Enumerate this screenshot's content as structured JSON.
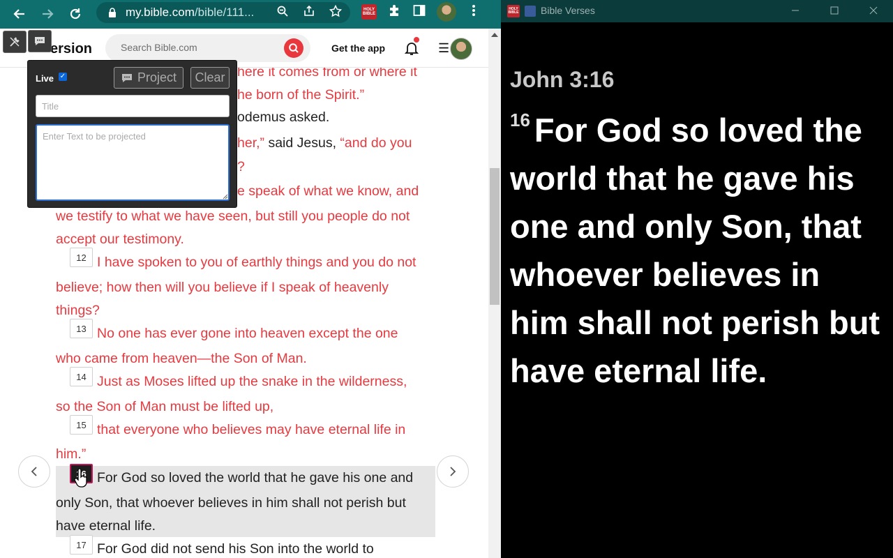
{
  "browser": {
    "url_host": "my.bible.com",
    "url_path": "/bible/111...",
    "ext_label": "HOLY BIBLE"
  },
  "site": {
    "logo_text": "ersion",
    "search_placeholder": "Search Bible.com",
    "get_app": "Get the app"
  },
  "toolbox": {
    "live_label": "Live",
    "live_checked": true,
    "project_label": "Project",
    "clear_label": "Clear",
    "title_placeholder": "Title",
    "text_placeholder": "Enter Text to be projected"
  },
  "passage": {
    "lines": [
      {
        "text": "here it comes from or where it",
        "color": "red"
      },
      {
        "text": "he born of the Spirit.”",
        "color": "red"
      },
      {
        "text": "odemus asked.",
        "color": "black"
      },
      {
        "text": "her,”",
        "color": "red"
      },
      {
        "text": " said Jesus, ",
        "color": "black"
      },
      {
        "text": "“and do you",
        "color": "red"
      },
      {
        "text": "?",
        "color": "red"
      },
      {
        "text": "e speak of what we know, and",
        "color": "red"
      },
      {
        "text": "we testify to what we have seen, but still you people do not",
        "color": "red"
      },
      {
        "text": "accept our testimony.",
        "color": "red"
      },
      {
        "text": "I have spoken to you of earthly things and you do not",
        "color": "red"
      },
      {
        "text": "believe; how then will you believe if I speak of heavenly",
        "color": "red"
      },
      {
        "text": "things?",
        "color": "red"
      },
      {
        "text": "No one has ever gone into heaven except the one",
        "color": "red"
      },
      {
        "text": "who came from heaven—the Son of Man.",
        "color": "red"
      },
      {
        "text": "Just as Moses lifted up the snake in the wilderness,",
        "color": "red"
      },
      {
        "text": "so the Son of Man must be lifted up,",
        "color": "red"
      },
      {
        "text": "that everyone who believes may have eternal life in",
        "color": "red"
      },
      {
        "text": "him.”",
        "color": "red"
      },
      {
        "text": "For God so loved the world that he gave his one and",
        "color": "black"
      },
      {
        "text": "only Son, that whoever believes in him shall not perish but",
        "color": "black"
      },
      {
        "text": "have eternal life.",
        "color": "black"
      },
      {
        "text": "For God did not send his Son into the world to",
        "color": "black"
      }
    ],
    "verse_numbers": [
      "12",
      "13",
      "14",
      "15",
      "16",
      "17"
    ],
    "selected_verse": "16"
  },
  "projection": {
    "window_title": "Bible Verses",
    "reference": "John 3:16",
    "verse_num": "16",
    "verse_text": "For God so loved the world that he gave his one and only Son, that whoever believes in him shall not perish but have eternal life."
  },
  "colors": {
    "chrome_teal": "#0f6e6e",
    "red_letter": "#e53a40",
    "accent_red": "#e8383d",
    "selected_border": "#c0185a"
  }
}
